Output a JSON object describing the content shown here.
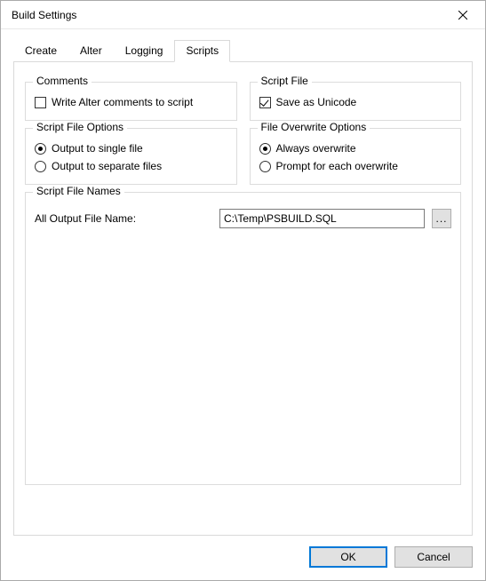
{
  "window": {
    "title": "Build Settings"
  },
  "tabs": {
    "create": "Create",
    "alter": "Alter",
    "logging": "Logging",
    "scripts": "Scripts"
  },
  "groups": {
    "comments": {
      "title": "Comments",
      "write_alter": {
        "label": "Write Alter comments to script",
        "checked": false
      }
    },
    "script_file": {
      "title": "Script File",
      "unicode": {
        "label": "Save as Unicode",
        "checked": true
      }
    },
    "script_file_options": {
      "title": "Script File Options",
      "single": {
        "label": "Output to single file",
        "selected": true
      },
      "separate": {
        "label": "Output to separate files",
        "selected": false
      }
    },
    "file_overwrite": {
      "title": "File Overwrite Options",
      "always": {
        "label": "Always overwrite",
        "selected": true
      },
      "prompt": {
        "label": "Prompt for each overwrite",
        "selected": false
      }
    },
    "script_file_names": {
      "title": "Script File Names",
      "all_output_label": "All Output File Name:",
      "all_output_value": "C:\\Temp\\PSBUILD.SQL",
      "browse_label": "..."
    }
  },
  "buttons": {
    "ok": "OK",
    "cancel": "Cancel"
  }
}
